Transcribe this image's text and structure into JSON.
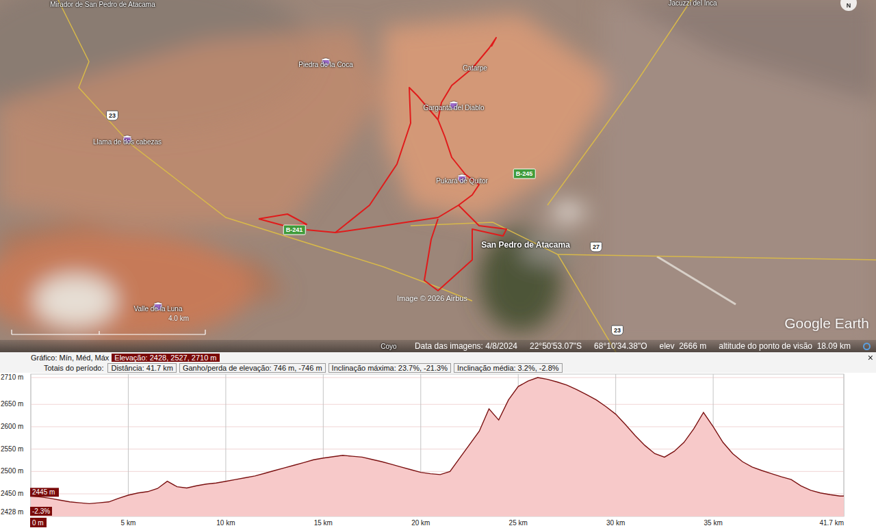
{
  "map": {
    "places": [
      {
        "name": "Mirador de San Pedro de Atacama",
        "kind": "label"
      },
      {
        "name": "Jacuzzi del Inca",
        "kind": "label"
      },
      {
        "name": "Piedra de la Coca",
        "kind": "pin"
      },
      {
        "name": "Catarpe",
        "kind": "label"
      },
      {
        "name": "Garganta del Diablo",
        "kind": "pin"
      },
      {
        "name": "Llama de dos cabezas",
        "kind": "pin"
      },
      {
        "name": "Pukará de Quitor",
        "kind": "pin"
      },
      {
        "name": "San Pedro de Atacama",
        "kind": "town"
      },
      {
        "name": "Valle de la Luna",
        "kind": "pin"
      },
      {
        "name": "Coyo",
        "kind": "label"
      }
    ],
    "roads": [
      {
        "label": "23",
        "kind": "national"
      },
      {
        "label": "B-241",
        "kind": "regional"
      },
      {
        "label": "B-245",
        "kind": "regional"
      },
      {
        "label": "27",
        "kind": "national"
      },
      {
        "label": "23",
        "kind": "national"
      }
    ],
    "compass": "N",
    "scale": "4.0 km",
    "copyright": "Image © 2026 Airbus",
    "logo": "Google Earth"
  },
  "status_bar": {
    "date": "Data das imagens: 4/8/2024",
    "lat": "22°50'53.07\"S",
    "lon": "68°10'34.38\"O",
    "elev": "elev  2666 m",
    "eye_alt": "altitude do ponto de visão  18.09 km"
  },
  "profile": {
    "chart_label": "Gráfico: Mín, Méd, Máx",
    "elevation": "Elevação: 2428, 2527, 2710 m",
    "close": "×",
    "totals_label": "Totais do período:",
    "totals": [
      "Distância: 41.7 km",
      "Ganho/perda de elevação: 746 m, -746 m",
      "Inclinação máxima: 23.7%, -21.3%",
      "Inclinação média: 3.2%, -2.8%"
    ],
    "y_ticks": [
      "2710 m",
      "2650 m",
      "2600 m",
      "2550 m",
      "2500 m",
      "2450 m"
    ],
    "x_ticks": [
      "0 m",
      "5 km",
      "10 km",
      "15 km",
      "20 km",
      "25 km",
      "30 km",
      "35 km",
      "41.7 km"
    ],
    "cursor_elev": "2445 m",
    "min_label": "2428 m",
    "cursor_slope": "-2.3%",
    "distances_km": [
      0,
      0.5,
      1,
      1.5,
      2,
      2.5,
      3,
      3.5,
      4,
      4.5,
      5,
      5.5,
      6,
      6.5,
      7,
      7.5,
      8,
      8.5,
      9,
      9.5,
      10,
      10.5,
      11,
      11.5,
      12,
      12.5,
      13,
      13.5,
      14,
      14.5,
      15,
      15.5,
      16,
      16.5,
      17,
      17.5,
      18,
      18.5,
      19,
      19.5,
      20,
      20.5,
      21,
      21.5,
      22,
      22.5,
      23,
      23.5,
      24,
      24.5,
      25,
      25.5,
      26,
      26.5,
      27,
      27.5,
      28,
      28.5,
      29,
      29.5,
      30,
      30.5,
      31,
      31.5,
      32,
      32.5,
      33,
      33.5,
      34,
      34.5,
      35,
      35.5,
      36,
      36.5,
      37,
      37.5,
      38,
      38.5,
      39,
      39.5,
      40,
      40.5,
      41,
      41.5,
      41.7
    ],
    "elevations_m": [
      2445,
      2443,
      2440,
      2436,
      2432,
      2430,
      2428,
      2430,
      2432,
      2440,
      2447,
      2452,
      2455,
      2462,
      2478,
      2466,
      2463,
      2468,
      2472,
      2474,
      2478,
      2482,
      2486,
      2490,
      2496,
      2502,
      2508,
      2514,
      2520,
      2526,
      2530,
      2533,
      2536,
      2534,
      2532,
      2527,
      2522,
      2516,
      2510,
      2504,
      2498,
      2495,
      2493,
      2500,
      2530,
      2560,
      2590,
      2640,
      2615,
      2660,
      2690,
      2702,
      2710,
      2706,
      2700,
      2693,
      2683,
      2672,
      2660,
      2645,
      2628,
      2605,
      2580,
      2558,
      2540,
      2532,
      2545,
      2565,
      2595,
      2632,
      2600,
      2565,
      2540,
      2522,
      2510,
      2502,
      2495,
      2488,
      2482,
      2468,
      2458,
      2452,
      2448,
      2445,
      2445
    ]
  }
}
